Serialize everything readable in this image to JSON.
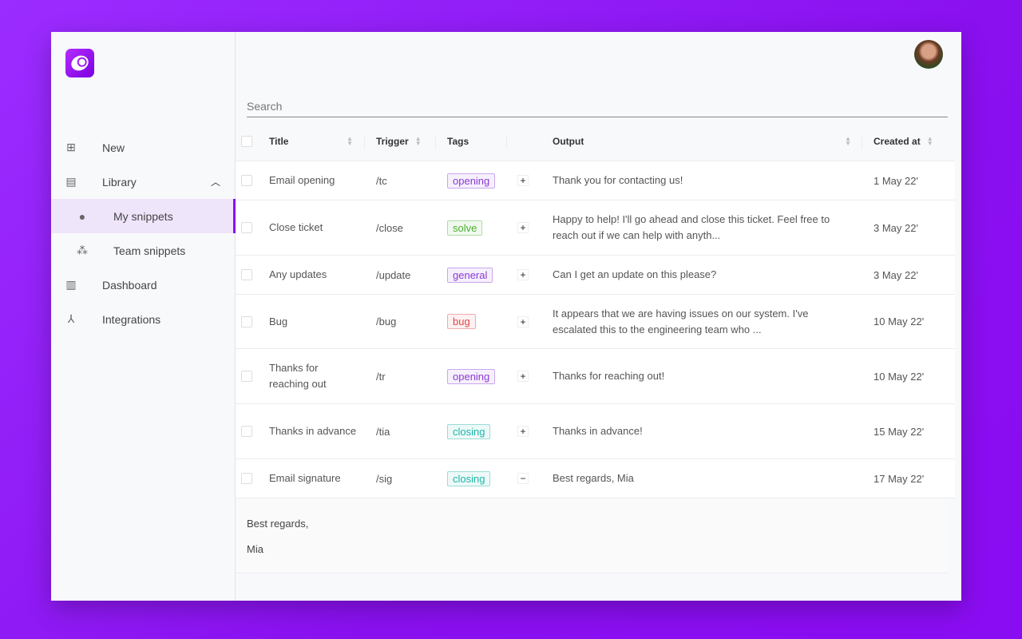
{
  "sidebar": {
    "items": [
      {
        "label": "New",
        "icon": "add-library-icon"
      },
      {
        "label": "Library",
        "icon": "library-icon",
        "expanded": true
      },
      {
        "label": "My snippets",
        "icon": "person-icon",
        "sub": true,
        "active": true
      },
      {
        "label": "Team snippets",
        "icon": "group-icon",
        "sub": true
      },
      {
        "label": "Dashboard",
        "icon": "bar-chart-icon"
      },
      {
        "label": "Integrations",
        "icon": "integrations-icon"
      }
    ]
  },
  "search": {
    "placeholder": "Search"
  },
  "table": {
    "headers": {
      "title": "Title",
      "trigger": "Trigger",
      "tags": "Tags",
      "output": "Output",
      "created": "Created at"
    },
    "rows": [
      {
        "title": "Email opening",
        "trigger": "/tc",
        "tag": "opening",
        "tag_color": "#8a3ad6",
        "output": "Thank you for contacting us!",
        "created": "1 May 22'",
        "expanded": false
      },
      {
        "title": "Close ticket",
        "trigger": "/close",
        "tag": "solve",
        "tag_color": "#4caf30",
        "output": "Happy to help! I'll go ahead and close this ticket. Feel free to reach out if we can help with anyth...",
        "created": "3 May 22'",
        "expanded": false
      },
      {
        "title": "Any updates",
        "trigger": "/update",
        "tag": "general",
        "tag_color": "#8a3ad6",
        "output": "Can I get an update on this please?",
        "created": "3 May 22'",
        "expanded": false
      },
      {
        "title": "Bug",
        "trigger": "/bug",
        "tag": "bug",
        "tag_color": "#e0474c",
        "output": "It appears that we are having issues on our system. I've escalated this to the engineering team who ...",
        "created": "10 May 22'",
        "expanded": false
      },
      {
        "title": "Thanks for reaching out",
        "trigger": "/tr",
        "tag": "opening",
        "tag_color": "#8a3ad6",
        "output": "Thanks for reaching out!",
        "created": "10 May 22'",
        "expanded": false
      },
      {
        "title": "Thanks in advance",
        "trigger": "/tia",
        "tag": "closing",
        "tag_color": "#1fb5a8",
        "output": "Thanks in advance!",
        "created": "15 May 22'",
        "expanded": false
      },
      {
        "title": "Email signature",
        "trigger": "/sig",
        "tag": "closing",
        "tag_color": "#1fb5a8",
        "output": "Best regards, Mia",
        "created": "17 May 22'",
        "expanded": true
      }
    ],
    "expanded_content": [
      "Best regards,",
      "Mia"
    ]
  },
  "colors": {
    "accent": "#8a10f0"
  }
}
